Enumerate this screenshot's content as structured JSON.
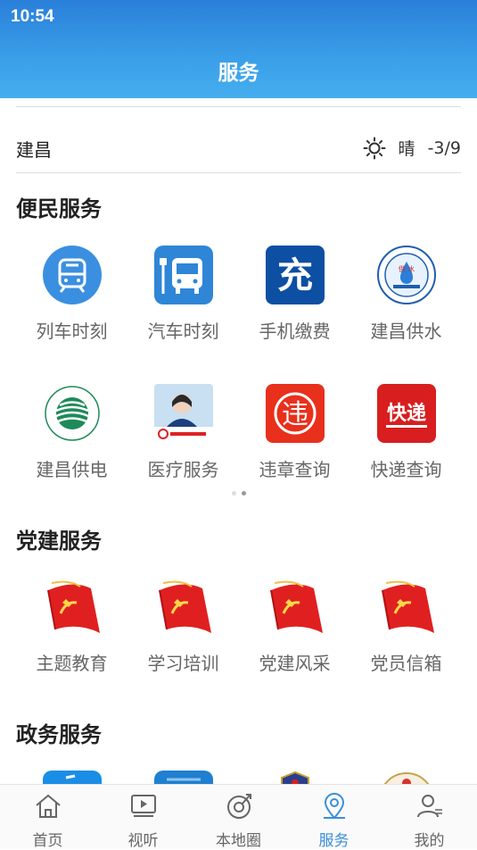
{
  "status_bar": {
    "time": "10:54"
  },
  "header": {
    "title": "服务"
  },
  "weather": {
    "city": "建昌",
    "condition": "晴",
    "temperature": "-3/9",
    "icon": "sun-icon"
  },
  "sections": [
    {
      "title": "便民服务",
      "items": [
        {
          "label": "列车时刻",
          "icon": "train-icon"
        },
        {
          "label": "汽车时刻",
          "icon": "bus-icon"
        },
        {
          "label": "手机缴费",
          "icon": "recharge-icon"
        },
        {
          "label": "建昌供水",
          "icon": "water-supply-logo"
        },
        {
          "label": "建昌供电",
          "icon": "state-grid-logo"
        },
        {
          "label": "医疗服务",
          "icon": "medical-service-image"
        },
        {
          "label": "违章查询",
          "icon": "violation-icon"
        },
        {
          "label": "快递查询",
          "icon": "express-icon"
        }
      ],
      "pager": {
        "pages": 2,
        "current": 2
      }
    },
    {
      "title": "党建服务",
      "items": [
        {
          "label": "主题教育",
          "icon": "party-flag-icon"
        },
        {
          "label": "学习培训",
          "icon": "party-flag-icon"
        },
        {
          "label": "党建风采",
          "icon": "party-flag-icon"
        },
        {
          "label": "党员信箱",
          "icon": "party-flag-icon"
        }
      ]
    },
    {
      "title": "政务服务"
    }
  ],
  "recharge_glyph": "充",
  "water_glyph": "供 水",
  "violation_glyph": "违",
  "express_glyph": "快递",
  "tabbar": [
    {
      "label": "首页",
      "icon": "home-icon",
      "active": false
    },
    {
      "label": "视听",
      "icon": "video-icon",
      "active": false
    },
    {
      "label": "本地圈",
      "icon": "local-circle-icon",
      "active": false
    },
    {
      "label": "服务",
      "icon": "location-pin-icon",
      "active": true
    },
    {
      "label": "我的",
      "icon": "user-icon",
      "active": false
    }
  ],
  "colors": {
    "header_top": "#2a7fd9",
    "header_bottom": "#46aeef",
    "accent": "#3a8fd9",
    "party_red": "#e02020"
  }
}
